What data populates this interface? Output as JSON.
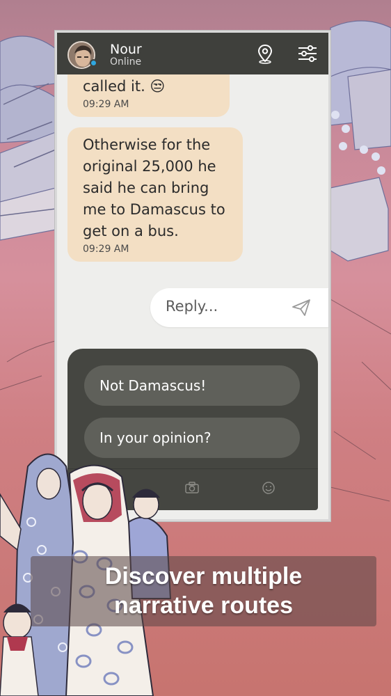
{
  "contact": {
    "name": "Nour",
    "status": "Online"
  },
  "header_icons": [
    "location-pin-icon",
    "settings-sliders-icon"
  ],
  "messages": [
    {
      "text": "called it. 😒",
      "time": "09:29 AM"
    },
    {
      "text": "Otherwise for the original 25,000 he said he can bring me to Damascus to get on a bus.",
      "time": "09:29 AM"
    }
  ],
  "reply": {
    "placeholder": "Reply..."
  },
  "choices": [
    {
      "label": "Not Damascus!"
    },
    {
      "label": "In your opinion?"
    }
  ],
  "toolbar_icons": [
    "camera-icon",
    "emoji-icon"
  ],
  "caption": {
    "line1": "Discover multiple",
    "line2": "narrative routes"
  },
  "colors": {
    "header": "#3f403c",
    "bubble": "#f3dfc4",
    "choice_panel": "#454641",
    "choice_button": "#5f605a",
    "status_dot": "#2fa7e0"
  }
}
